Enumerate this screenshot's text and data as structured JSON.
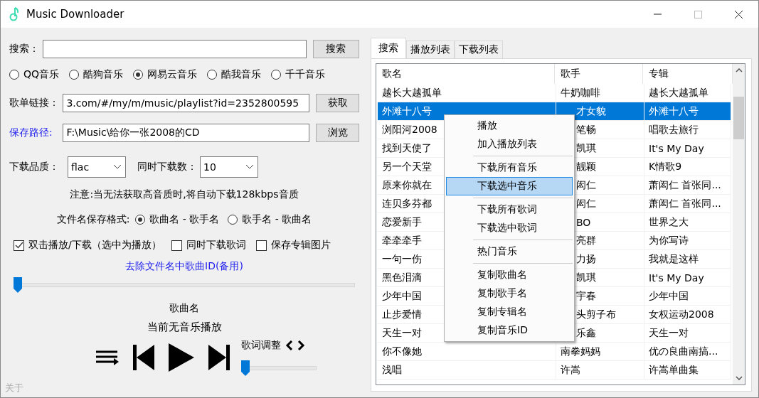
{
  "window": {
    "title": "Music Downloader"
  },
  "search": {
    "label": "搜索：",
    "button": "搜索"
  },
  "sources": [
    {
      "label": "QQ音乐",
      "selected": false
    },
    {
      "label": "酷狗音乐",
      "selected": false
    },
    {
      "label": "网易云音乐",
      "selected": true
    },
    {
      "label": "酷我音乐",
      "selected": false
    },
    {
      "label": "千千音乐",
      "selected": false
    }
  ],
  "playlist": {
    "label": "歌单链接：",
    "value": "3.com/#/my/m/music/playlist?id=2352800595",
    "button": "获取"
  },
  "save_path": {
    "label": "保存路径:",
    "value": "F:\\Music\\给你一张2008的CD",
    "button": "浏览"
  },
  "quality": {
    "label": "下载品质：",
    "value": "flac"
  },
  "concurrency": {
    "label": "同时下载数：",
    "value": "10"
  },
  "note": "注意:当无法获取高音质时,将自动下载128kbps音质",
  "filename_format": {
    "label": "文件名保存格式:",
    "options": [
      {
        "label": "歌曲名 - 歌手名",
        "selected": true
      },
      {
        "label": "歌手名 - 歌曲名",
        "selected": false
      }
    ]
  },
  "options": [
    {
      "label": "双击播放/下载（选中为播放）",
      "checked": true
    },
    {
      "label": "同时下载歌词",
      "checked": false
    },
    {
      "label": "保存专辑图片",
      "checked": false
    }
  ],
  "remove_id_link": "去除文件名中歌曲ID(备用)",
  "progress": {
    "level": 0
  },
  "player": {
    "song": "歌曲名",
    "status": "当前无音乐播放",
    "lyrics_label": "歌词调整",
    "lyrics_slider": {
      "level": 0
    }
  },
  "about": "关于",
  "tabs": [
    {
      "label": "搜索",
      "selected": true
    },
    {
      "label": "播放列表",
      "selected": false
    },
    {
      "label": "下载列表",
      "selected": false
    }
  ],
  "table": {
    "columns": [
      "歌名",
      "歌手",
      "专辑"
    ],
    "rows": [
      {
        "cells": [
          "越长大越孤单",
          "牛奶咖啡",
          "越长大越孤单"
        ],
        "selected": false
      },
      {
        "cells": [
          "外滩十八号",
          "才女貌",
          "外滩十八号"
        ],
        "selected": true
      },
      {
        "cells": [
          "浏阳河2008",
          "笔畅",
          "唱歌去旅行"
        ],
        "selected": false
      },
      {
        "cells": [
          "找到天使了",
          "凯琪",
          "It's My Day"
        ],
        "selected": false
      },
      {
        "cells": [
          "另一个天堂",
          "靓颖",
          "K情歌9"
        ],
        "selected": false
      },
      {
        "cells": [
          "原来你就在",
          "闳仁",
          "萧闳仁 首张同..."
        ],
        "selected": false
      },
      {
        "cells": [
          "连贝多芬都",
          "闳仁",
          "萧闳仁 首张同..."
        ],
        "selected": false
      },
      {
        "cells": [
          "恋爱新手",
          "BO",
          "世界之大"
        ],
        "selected": false
      },
      {
        "cells": [
          "牵牵牵手",
          "亮群",
          "为你写诗"
        ],
        "selected": false
      },
      {
        "cells": [
          "一句一伤",
          "力扬",
          "我就是这样"
        ],
        "selected": false
      },
      {
        "cells": [
          "黑色泪滴",
          "凯琪",
          "It's My Day"
        ],
        "selected": false
      },
      {
        "cells": [
          "少年中国",
          "宇春",
          "少年中国"
        ],
        "selected": false
      },
      {
        "cells": [
          "止步爱情",
          "头剪子布",
          "女权运动2008"
        ],
        "selected": false
      },
      {
        "cells": [
          "天生一对",
          "乐鑫",
          "天生一对"
        ],
        "selected": false
      },
      {
        "cells": [
          "你不像她",
          "南拳妈妈",
          "优の良曲南搞..."
        ],
        "selected": false
      },
      {
        "cells": [
          "浅唱",
          "许嵩",
          "许嵩单曲集"
        ],
        "selected": false
      }
    ]
  },
  "context_menu": {
    "items": [
      {
        "kind": "item",
        "label": "播放",
        "selected": false
      },
      {
        "kind": "item",
        "label": "加入播放列表",
        "selected": false
      },
      {
        "kind": "separator"
      },
      {
        "kind": "item",
        "label": "下载所有音乐",
        "selected": false
      },
      {
        "kind": "item",
        "label": "下载选中音乐",
        "selected": true
      },
      {
        "kind": "separator"
      },
      {
        "kind": "item",
        "label": "下载所有歌词",
        "selected": false
      },
      {
        "kind": "item",
        "label": "下载选中歌词",
        "selected": false
      },
      {
        "kind": "separator"
      },
      {
        "kind": "item",
        "label": "热门音乐",
        "selected": false
      },
      {
        "kind": "separator"
      },
      {
        "kind": "item",
        "label": "复制歌曲名",
        "selected": false
      },
      {
        "kind": "item",
        "label": "复制歌手名",
        "selected": false
      },
      {
        "kind": "item",
        "label": "复制专辑名",
        "selected": false
      },
      {
        "kind": "item",
        "label": "复制音乐ID",
        "selected": false
      }
    ]
  }
}
